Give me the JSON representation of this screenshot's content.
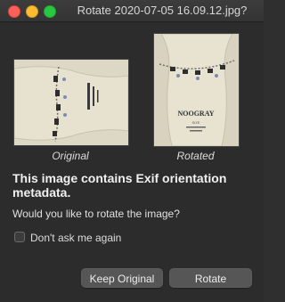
{
  "window": {
    "title": "Rotate 2020-07-05 16.09.12.jpg?"
  },
  "preview": {
    "original_caption": "Original",
    "rotated_caption": "Rotated",
    "label_brand": "NOOGRAY",
    "label_line": "SIZE"
  },
  "message": {
    "headline": "This image contains Exif orientation metadata.",
    "question": "Would you like to rotate the image?"
  },
  "options": {
    "dont_ask_label": "Don't ask me again",
    "dont_ask_checked": false
  },
  "buttons": {
    "keep_original": "Keep Original",
    "rotate": "Rotate"
  },
  "colors": {
    "close": "#fe5f57",
    "minimize": "#febc2e",
    "zoom": "#28c840",
    "background": "#2c2c2c"
  }
}
